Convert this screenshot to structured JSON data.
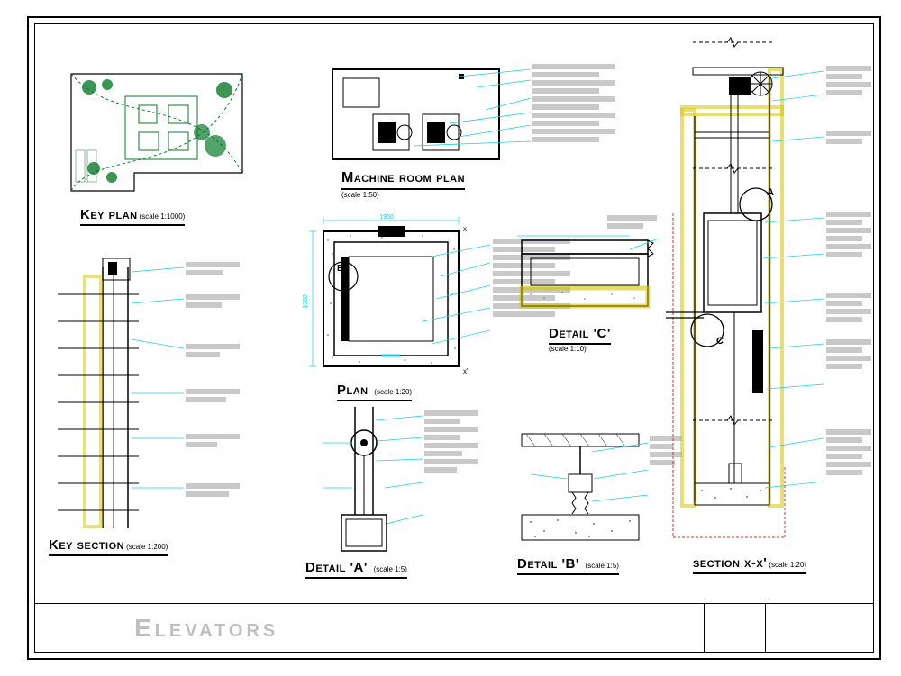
{
  "sheet": {
    "title": "Elevators"
  },
  "panels": {
    "key_plan": {
      "title": "Key plan",
      "scale": "(scale 1:1000)"
    },
    "machine": {
      "title": "Machine room plan",
      "scale": "(scale 1:50)"
    },
    "plan": {
      "title": "Plan",
      "scale": "(scale 1:20)",
      "dims": {
        "w": "1960",
        "h": "1960",
        "marker_x": "x",
        "marker_b": "B"
      }
    },
    "key_section": {
      "title": "Key section",
      "scale": "(scale 1:200)"
    },
    "detail_a": {
      "title": "Detail 'A'",
      "scale": "(scale 1:5)"
    },
    "detail_b": {
      "title": "Detail 'B'",
      "scale": "(scale 1:5)"
    },
    "detail_c": {
      "title": "Detail 'C'",
      "scale": "(scale 1:10)",
      "markers": {
        "a": "A",
        "c": "C"
      }
    },
    "section_xx": {
      "title": "section x-x'",
      "scale": "(scale 1:20)"
    }
  }
}
